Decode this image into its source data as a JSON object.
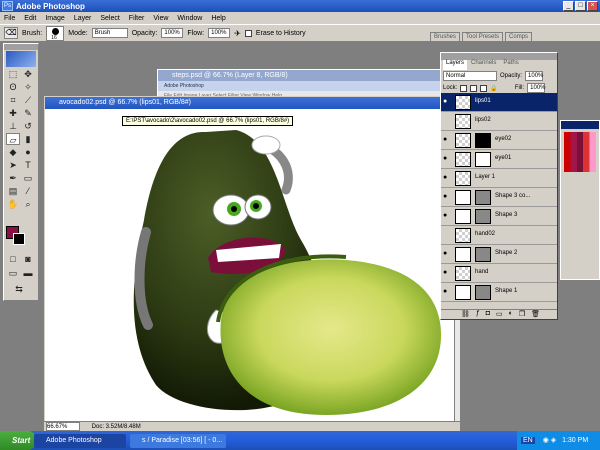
{
  "app": {
    "title": "Adobe Photoshop",
    "logo_text": "Ps"
  },
  "menu": [
    "File",
    "Edit",
    "Image",
    "Layer",
    "Select",
    "Filter",
    "View",
    "Window",
    "Help"
  ],
  "options": {
    "brush_label": "Brush:",
    "brush_size": "16",
    "mode_label": "Mode:",
    "mode_value": "Brush",
    "opacity_label": "Opacity:",
    "opacity_value": "100%",
    "flow_label": "Flow:",
    "flow_value": "100%",
    "erase_history_label": "Erase to History"
  },
  "palette_well_tabs": [
    "Brushes",
    "Tool Presets",
    "Comps"
  ],
  "bg_document": {
    "title": "steps.psd @ 66.7% (Layer 8, RGB/8)",
    "inner_title": "Adobe Photoshop",
    "inner_menu": "File  Edit  Image  Layer  Select  Filter  View  Window  Help"
  },
  "document": {
    "title": "avocado02.psd @ 66.7% (lips01, RGB/8#)",
    "tooltip": "E:\\PST\\avocado\\2\\avocado02.psd @ 66.7% (lips01, RGB/8#)",
    "zoom": "66.67%",
    "doc_size": "Doc: 3.52M/8.48M"
  },
  "layers_panel": {
    "tabs": [
      "Layers",
      "Channels",
      "Paths"
    ],
    "blend_mode": "Normal",
    "opacity_label": "Opacity:",
    "opacity_value": "100%",
    "lock_label": "Lock:",
    "fill_label": "Fill:",
    "fill_value": "100%",
    "layers": [
      {
        "name": "lips01",
        "selected": true
      },
      {
        "name": "lips02",
        "selected": false
      },
      {
        "name": "eye02",
        "selected": false
      },
      {
        "name": "eye01",
        "selected": false
      },
      {
        "name": "Layer 1",
        "selected": false
      },
      {
        "name": "Shape 3 co...",
        "selected": false
      },
      {
        "name": "Shape 3",
        "selected": false
      },
      {
        "name": "hand02",
        "selected": false
      },
      {
        "name": "Shape 2",
        "selected": false
      },
      {
        "name": "hand",
        "selected": false
      },
      {
        "name": "Shape 1",
        "selected": false
      }
    ]
  },
  "colors": {
    "foreground": "#8a0f43",
    "background": "#000000",
    "selected_layer": "#0a246a"
  },
  "taskbar": {
    "start_label": "Start",
    "tasks": [
      "Adobe Photoshop",
      "s / Paradise [03:56] [ - 0..."
    ],
    "lang": "EN",
    "time": "1:30 PM"
  }
}
